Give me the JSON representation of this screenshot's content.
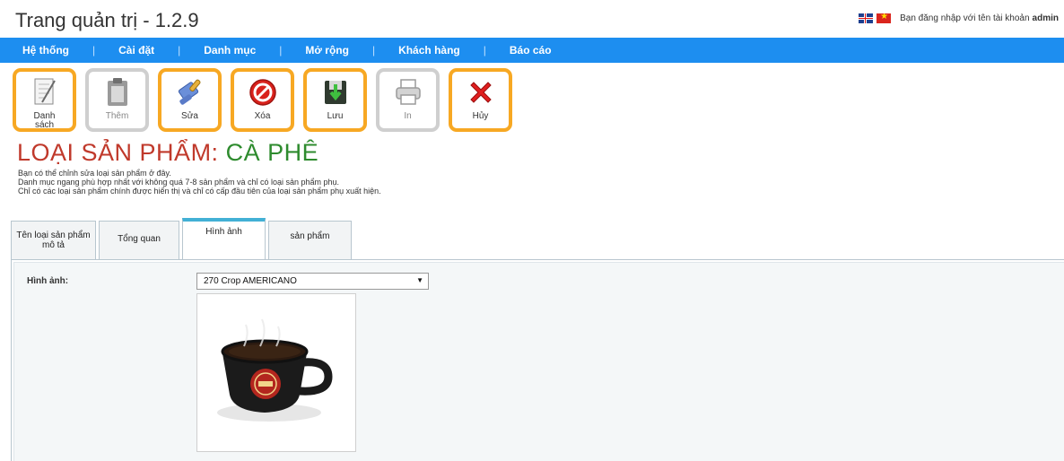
{
  "header": {
    "title": "Trang quản trị - 1.2.9",
    "login_text": "Bạn đăng nhập với tên tài khoản",
    "username": "admin"
  },
  "menu": {
    "items": [
      {
        "label": "Hệ thống"
      },
      {
        "label": "Cài đặt"
      },
      {
        "label": "Danh mục"
      },
      {
        "label": "Mở rộng"
      },
      {
        "label": "Khách hàng"
      },
      {
        "label": "Báo cáo"
      }
    ]
  },
  "toolbar": {
    "buttons": [
      {
        "label": "Danh sách",
        "icon": "list-notepad-icon",
        "enabled": true
      },
      {
        "label": "Thêm",
        "icon": "clipboard-add-icon",
        "enabled": false
      },
      {
        "label": "Sửa",
        "icon": "edit-brush-icon",
        "enabled": true
      },
      {
        "label": "Xóa",
        "icon": "delete-stop-icon",
        "enabled": true
      },
      {
        "label": "Lưu",
        "icon": "save-icon",
        "enabled": true
      },
      {
        "label": "In",
        "icon": "printer-icon",
        "enabled": false
      },
      {
        "label": "Hủy",
        "icon": "cancel-x-icon",
        "enabled": true
      }
    ]
  },
  "page": {
    "heading_prefix": "LOẠI SẢN PHẨM:",
    "heading_name": "CÀ PHÊ",
    "description_lines": [
      "Bạn có thể chỉnh sửa loại sản phẩm ở đây.",
      "Danh mục ngang phù hợp nhất với không quá 7-8 sản phẩm và chỉ có loại sản phẩm phụ.",
      "Chỉ có các loại sản phẩm chính được hiển thị và chỉ có cấp đầu tiên của loại sản phẩm phụ xuất hiện."
    ]
  },
  "tabs": [
    {
      "line1": "Tên loại sản phẩm",
      "line2": "mô tả",
      "active": false
    },
    {
      "line1": "Tổng quan",
      "line2": "",
      "active": false
    },
    {
      "line1": "Hình ảnh",
      "line2": "",
      "active": true
    },
    {
      "line1": "sản phẩm",
      "line2": "",
      "active": false
    }
  ],
  "image_form": {
    "label": "Hình ảnh:",
    "selected": "270 Crop AMERICANO",
    "preview_alt": "Highlands Coffee cup"
  },
  "colors": {
    "menubar": "#1d8ef0",
    "toolbar_border_active": "#f7a823",
    "toolbar_border_disabled": "#cfcfcf",
    "heading_prefix": "#c0392b",
    "heading_name": "#2e8b2e",
    "active_tab_top": "#42b0d5"
  }
}
